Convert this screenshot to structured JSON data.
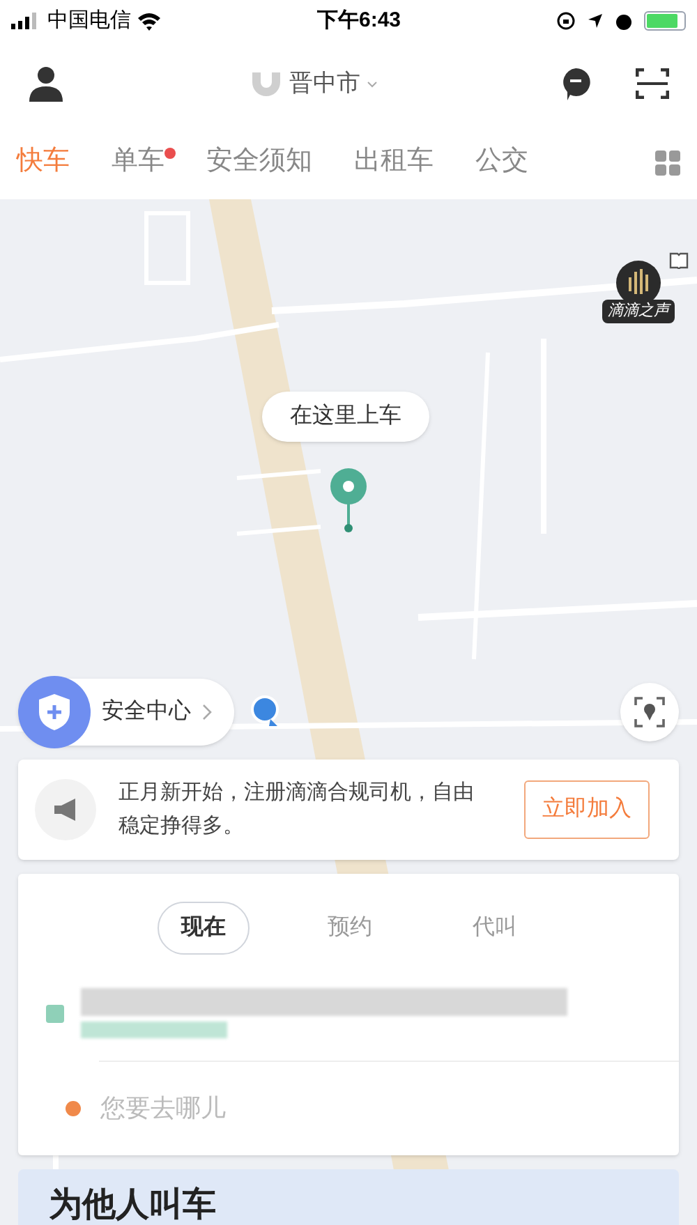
{
  "status_bar": {
    "carrier": "中国电信",
    "time": "下午6:43"
  },
  "header": {
    "city": "晋中市"
  },
  "tabs": [
    {
      "label": "快车",
      "selected": true,
      "dot": false
    },
    {
      "label": "单车",
      "selected": false,
      "dot": true
    },
    {
      "label": "安全须知",
      "selected": false,
      "dot": false
    },
    {
      "label": "出租车",
      "selected": false,
      "dot": false
    },
    {
      "label": "公交",
      "selected": false,
      "dot": false
    }
  ],
  "map": {
    "pickup_label": "在这里上车",
    "voice_badge": "滴滴之声"
  },
  "safety_center": {
    "label": "安全中心"
  },
  "notice": {
    "text": "正月新开始，注册滴滴合规司机，自由稳定挣得多。",
    "button": "立即加入"
  },
  "booking": {
    "modes": [
      {
        "label": "现在",
        "selected": true
      },
      {
        "label": "预约",
        "selected": false
      },
      {
        "label": "代叫",
        "selected": false
      }
    ],
    "destination": {
      "placeholder": "您要去哪儿"
    }
  },
  "promo": {
    "title": "为他人叫车"
  }
}
